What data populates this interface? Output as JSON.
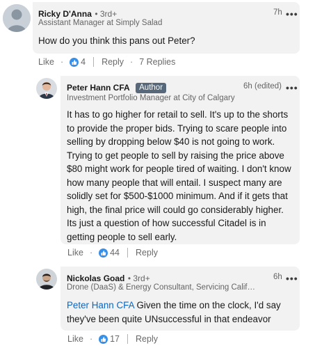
{
  "comments": [
    {
      "author": "Ricky D'Anna",
      "degree": "3rd+",
      "headline": "Assistant Manager at Simply Salad",
      "time": "7h",
      "text": "How do you think this pans out Peter?",
      "like_label": "Like",
      "like_count": "4",
      "reply_label": "Reply",
      "replies_label": "7 Replies"
    }
  ],
  "replies": [
    {
      "author": "Peter Hann CFA",
      "badge": "Author",
      "headline": "Investment Portfolio Manager at City of Calgary",
      "time": "6h (edited)",
      "text": "It has to go higher for retail to sell. It's up to the shorts to provide the proper bids. Trying to scare people into selling by dropping below $40 is not going to work. Trying to get people to sell by raising the price above $80 might work for people tired of waiting. I don't know how many people that will entail. I suspect many are solidly set for $500-$1000 minimum. And if it gets that high, the final price will could go considerably higher. Its just a question of how successful Citadel is in getting people to sell early.",
      "like_label": "Like",
      "like_count": "44",
      "reply_label": "Reply"
    },
    {
      "author": "Nickolas Goad",
      "degree": "3rd+",
      "headline": "Drone (DaaS) & Energy Consultant, Servicing Californi...",
      "time": "6h",
      "mention": "Peter Hann CFA",
      "text": "Given the time on the clock, I'd say they've been quite UNsuccessful in that endeavor",
      "like_label": "Like",
      "like_count": "17",
      "reply_label": "Reply"
    }
  ],
  "ui": {
    "separator_dot": "·",
    "more_dots": "•••"
  },
  "colors": {
    "bubble_bg": "#f2f2f2",
    "like_blue": "#378fe9",
    "mention_blue": "#0a66c2",
    "badge_bg": "#56687a"
  }
}
